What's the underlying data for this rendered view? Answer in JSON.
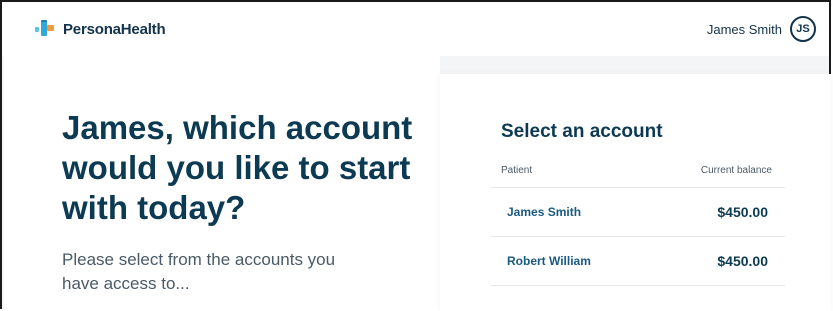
{
  "header": {
    "brand": "PersonaHealth",
    "user_name": "James Smith",
    "user_initials": "JS"
  },
  "intro": {
    "headline": "James, which account would you like to start with today?",
    "subtext": "Please select from the accounts you have access to..."
  },
  "account_card": {
    "title": "Select an account",
    "columns": {
      "patient": "Patient",
      "balance": "Current balance"
    },
    "rows": [
      {
        "name": "James Smith",
        "balance": "$450.00"
      },
      {
        "name": "Robert William",
        "balance": "$450.00"
      }
    ]
  },
  "colors": {
    "primary_text": "#0c3a52",
    "link_text": "#1a5a80",
    "logo_blue": "#33a8d8",
    "logo_orange": "#f29a3a"
  }
}
